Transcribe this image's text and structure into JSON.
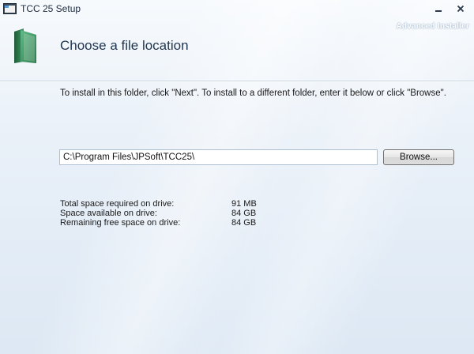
{
  "window": {
    "title": "TCC 25 Setup",
    "controls": {
      "minimize": "–",
      "close": "✕"
    }
  },
  "header": {
    "heading": "Choose a file location",
    "brand": "Advanced Installer"
  },
  "body": {
    "instruction": "To install in this folder, click \"Next\". To install to a different folder, enter it below or click \"Browse\".",
    "path_value": "C:\\Program Files\\JPSoft\\TCC25\\",
    "browse_label": "Browse..."
  },
  "space": {
    "rows": [
      {
        "label": "Total space required on drive:",
        "value": "91 MB"
      },
      {
        "label": "Space available on drive:",
        "value": "84 GB"
      },
      {
        "label": "Remaining free space on drive:",
        "value": "84 GB"
      }
    ]
  },
  "colors": {
    "heading": "#1f3550",
    "folder": "#2f7a4a",
    "background": "#e9f0f8"
  },
  "icons": {
    "app": "app-window-icon",
    "folder": "green-folder-icon"
  }
}
